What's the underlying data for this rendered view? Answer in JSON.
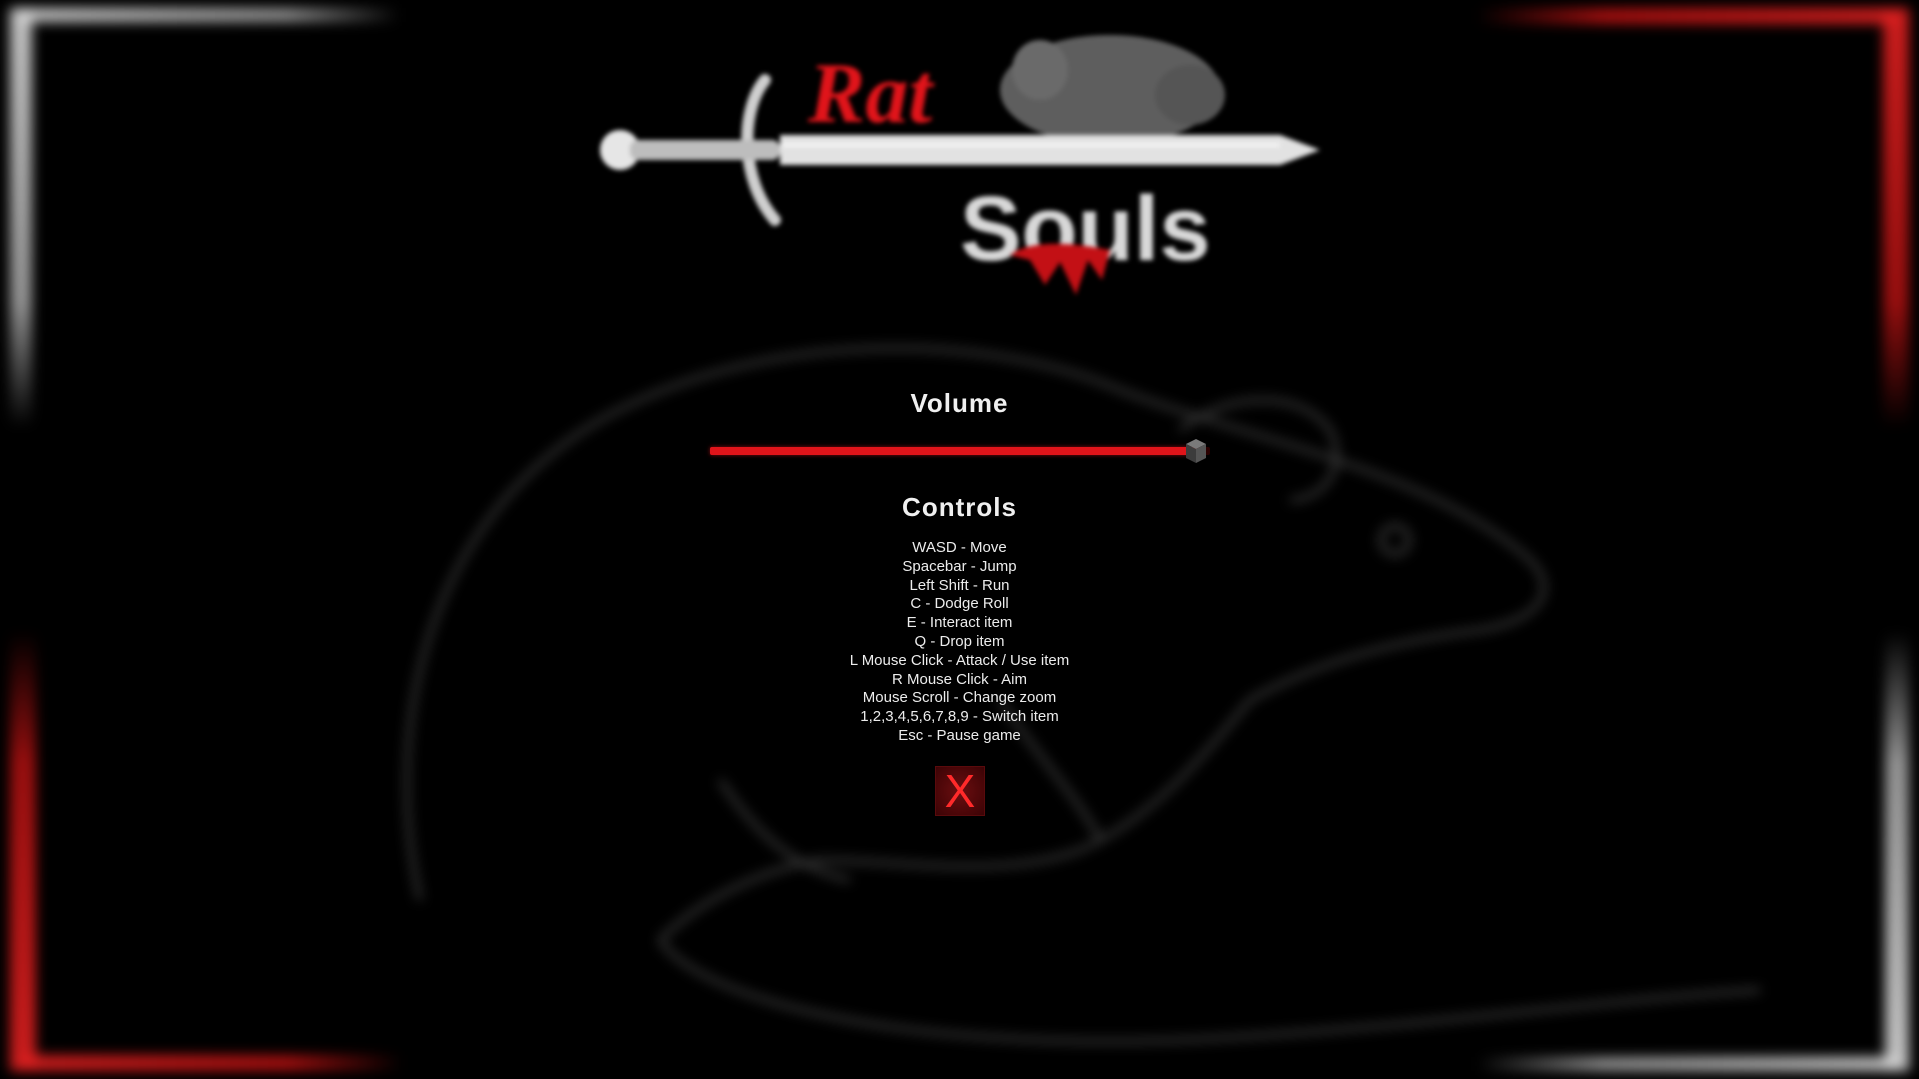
{
  "logo": {
    "title_top": "Rat",
    "title_bottom": "Souls"
  },
  "volume": {
    "title": "Volume",
    "level": 1.0,
    "fill_color": "#e0141a"
  },
  "controls": {
    "title": "Controls",
    "items": [
      "WASD - Move",
      "Spacebar - Jump",
      "Left Shift - Run",
      "C - Dodge Roll",
      "E - Interact item",
      "Q - Drop item",
      "L Mouse Click - Attack / Use item",
      "R Mouse Click - Aim",
      "Mouse Scroll - Change zoom",
      "1,2,3,4,5,6,7,8,9 - Switch item",
      "Esc - Pause game"
    ]
  },
  "close_button": {
    "label": "X"
  },
  "colors": {
    "accent": "#e0141a",
    "background": "#000000",
    "text": "#ececec"
  }
}
